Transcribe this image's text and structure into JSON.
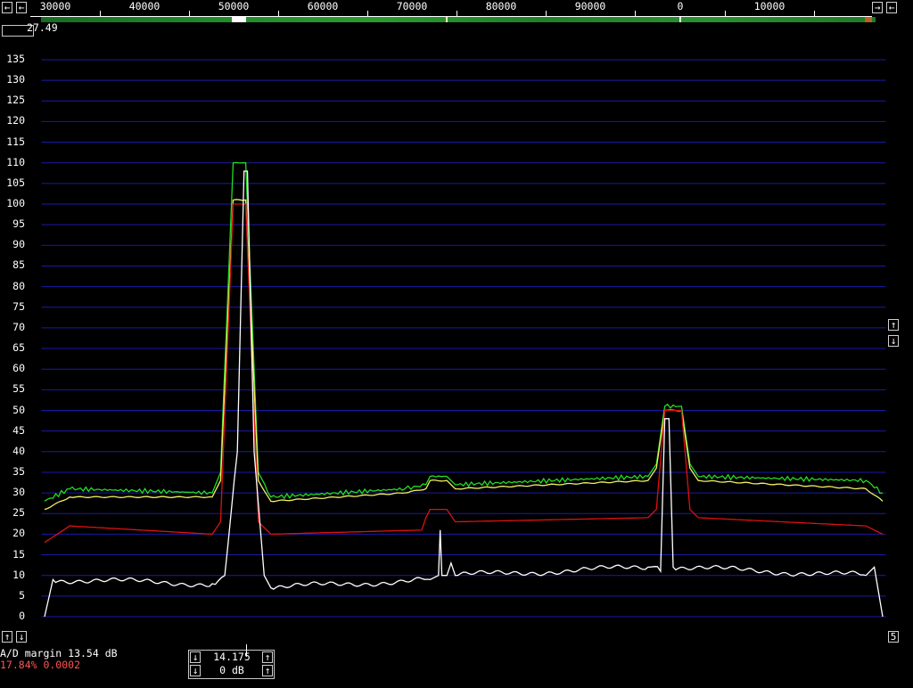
{
  "scale": {
    "freq_labels": [
      "30000",
      "40000",
      "50000",
      "60000",
      "70000",
      "80000",
      "90000",
      "0",
      "10000"
    ]
  },
  "top_buttons": {
    "left_a": "←",
    "left_b": "←",
    "right_a": "→",
    "right_b": "←"
  },
  "top_readout": "27.49",
  "y_axis": {
    "labels": [
      "135",
      "130",
      "125",
      "120",
      "115",
      "110",
      "105",
      "100",
      "95",
      "90",
      "85",
      "80",
      "75",
      "70",
      "65",
      "60",
      "55",
      "50",
      "45",
      "40",
      "35",
      "30",
      "25",
      "20",
      "15",
      "10",
      "5",
      "0"
    ]
  },
  "left_buttons": {
    "up": "↑",
    "down": "↓"
  },
  "right_buttons": {
    "up": "↑",
    "down": "↓",
    "five": "5"
  },
  "status": {
    "ad_margin": "A/D margin 13.54 dB",
    "percent_line": "17.84% 0.0002"
  },
  "center_control": {
    "freq": "14.175",
    "gain": "0 dB",
    "down_a": "↓",
    "down_b": "↓",
    "up_a": "↑",
    "up_b": "↑"
  },
  "colors": {
    "grid": "#1a1aa8",
    "green_trace": "#22dd22",
    "yellow_trace": "#f0f060",
    "red_trace": "#dd1111",
    "white_trace": "#ffffff",
    "percent_text": "#ff5555"
  },
  "chart_data": {
    "type": "line",
    "ylim": [
      0,
      137
    ],
    "y_ticks": [
      135,
      130,
      125,
      120,
      115,
      110,
      105,
      100,
      95,
      90,
      85,
      80,
      75,
      70,
      65,
      60,
      55,
      50,
      45,
      40,
      35,
      30,
      25,
      20,
      15,
      10,
      5,
      0
    ],
    "series": [
      {
        "color": "green",
        "points": [
          [
            0.0,
            28
          ],
          [
            0.03,
            31
          ],
          [
            0.2,
            30
          ],
          [
            0.21,
            35
          ],
          [
            0.225,
            110
          ],
          [
            0.24,
            110
          ],
          [
            0.255,
            35
          ],
          [
            0.27,
            29
          ],
          [
            0.43,
            31
          ],
          [
            0.455,
            32
          ],
          [
            0.46,
            34
          ],
          [
            0.48,
            34
          ],
          [
            0.49,
            32
          ],
          [
            0.72,
            34
          ],
          [
            0.73,
            37
          ],
          [
            0.74,
            51
          ],
          [
            0.76,
            51
          ],
          [
            0.77,
            37
          ],
          [
            0.78,
            34
          ],
          [
            0.98,
            33
          ],
          [
            1.0,
            30
          ]
        ]
      },
      {
        "color": "yellow",
        "points": [
          [
            0.0,
            26
          ],
          [
            0.03,
            29
          ],
          [
            0.2,
            29
          ],
          [
            0.21,
            33
          ],
          [
            0.225,
            101
          ],
          [
            0.24,
            101
          ],
          [
            0.255,
            33
          ],
          [
            0.27,
            28
          ],
          [
            0.43,
            30
          ],
          [
            0.455,
            31
          ],
          [
            0.46,
            33
          ],
          [
            0.48,
            33
          ],
          [
            0.49,
            31
          ],
          [
            0.72,
            33
          ],
          [
            0.73,
            36
          ],
          [
            0.74,
            50
          ],
          [
            0.76,
            50
          ],
          [
            0.77,
            36
          ],
          [
            0.78,
            33
          ],
          [
            0.98,
            31
          ],
          [
            1.0,
            28
          ]
        ]
      },
      {
        "color": "red",
        "points": [
          [
            0.0,
            18
          ],
          [
            0.03,
            22
          ],
          [
            0.2,
            20
          ],
          [
            0.21,
            23
          ],
          [
            0.225,
            100
          ],
          [
            0.24,
            100
          ],
          [
            0.255,
            23
          ],
          [
            0.27,
            20
          ],
          [
            0.45,
            21
          ],
          [
            0.455,
            24
          ],
          [
            0.46,
            26
          ],
          [
            0.48,
            26
          ],
          [
            0.49,
            23
          ],
          [
            0.72,
            24
          ],
          [
            0.73,
            26
          ],
          [
            0.74,
            50
          ],
          [
            0.76,
            50
          ],
          [
            0.77,
            26
          ],
          [
            0.78,
            24
          ],
          [
            0.98,
            22
          ],
          [
            1.0,
            20
          ]
        ]
      },
      {
        "color": "white",
        "points": [
          [
            0.0,
            0
          ],
          [
            0.01,
            9
          ],
          [
            0.2,
            8
          ],
          [
            0.215,
            10
          ],
          [
            0.23,
            40
          ],
          [
            0.238,
            108
          ],
          [
            0.242,
            108
          ],
          [
            0.25,
            40
          ],
          [
            0.262,
            10
          ],
          [
            0.27,
            7
          ],
          [
            0.46,
            9
          ],
          [
            0.47,
            10
          ],
          [
            0.472,
            21
          ],
          [
            0.474,
            10
          ],
          [
            0.48,
            10
          ],
          [
            0.485,
            13
          ],
          [
            0.49,
            10
          ],
          [
            0.72,
            12
          ],
          [
            0.735,
            11
          ],
          [
            0.74,
            48
          ],
          [
            0.745,
            48
          ],
          [
            0.75,
            12
          ],
          [
            0.98,
            10
          ],
          [
            0.99,
            12
          ],
          [
            1.0,
            0
          ]
        ]
      }
    ]
  }
}
